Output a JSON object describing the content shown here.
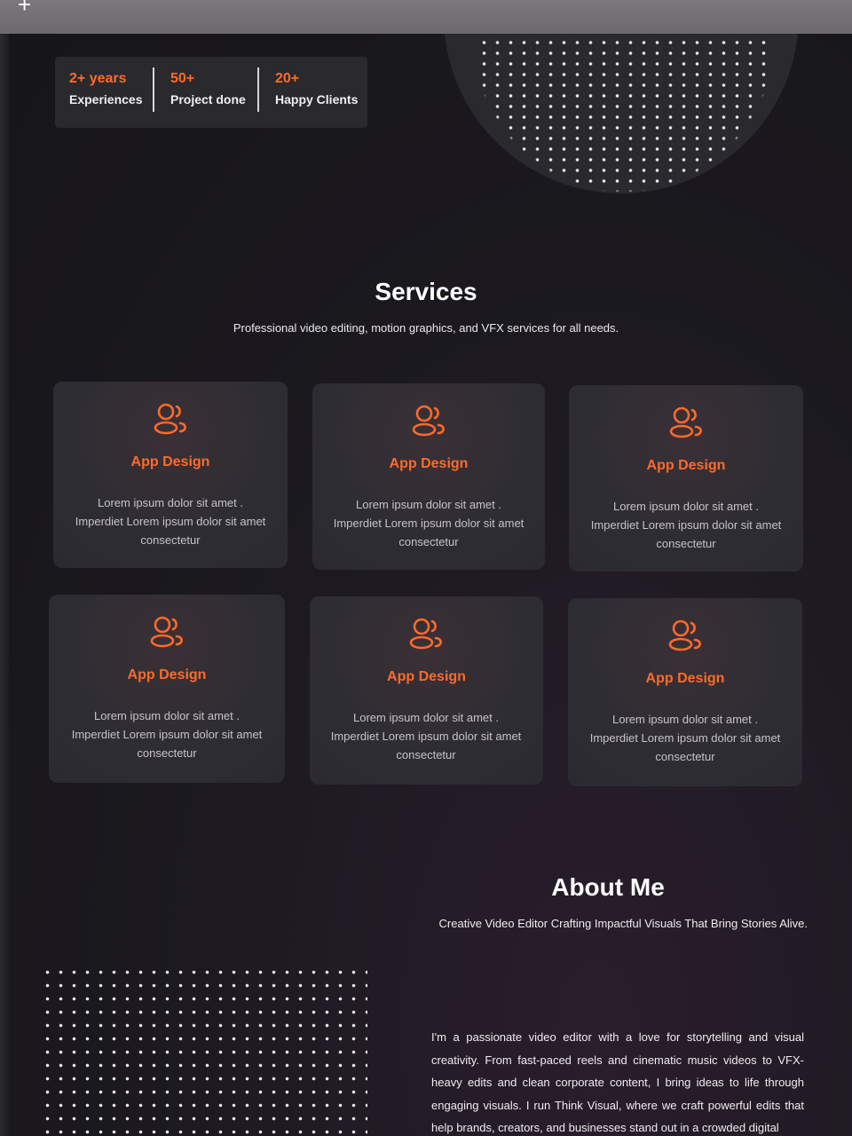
{
  "stats": [
    {
      "value": "2+ years",
      "label": "Experiences"
    },
    {
      "value": "50+",
      "label": "Project done"
    },
    {
      "value": "20+",
      "label": "Happy Clients"
    }
  ],
  "services": {
    "title": "Services",
    "subtitle": "Professional video editing, motion graphics, and VFX services for all needs.",
    "cards": [
      {
        "icon": "users-icon",
        "title": "App Design",
        "description": "Lorem ipsum dolor sit amet . Imperdiet Lorem ipsum dolor sit amet consectetur"
      },
      {
        "icon": "users-icon",
        "title": "App Design",
        "description": "Lorem ipsum dolor sit amet . Imperdiet Lorem ipsum dolor sit amet consectetur"
      },
      {
        "icon": "users-icon",
        "title": "App Design",
        "description": "Lorem ipsum dolor sit amet . Imperdiet Lorem ipsum dolor sit amet consectetur"
      },
      {
        "icon": "users-icon",
        "title": "App Design",
        "description": "Lorem ipsum dolor sit amet . Imperdiet Lorem ipsum dolor sit amet consectetur"
      },
      {
        "icon": "users-icon",
        "title": "App Design",
        "description": "Lorem ipsum dolor sit amet . Imperdiet Lorem ipsum dolor sit amet consectetur"
      },
      {
        "icon": "users-icon",
        "title": "App Design",
        "description": "Lorem ipsum dolor sit amet . Imperdiet Lorem ipsum dolor sit amet consectetur"
      }
    ]
  },
  "about": {
    "title": "About Me",
    "subtitle": "Creative Video Editor Crafting Impactful Visuals That Bring Stories Alive.",
    "body": "I'm a passionate video editor with a love for storytelling and visual creativity. From fast-paced reels and cinematic music videos to VFX-heavy edits and clean corporate content, I bring ideas to life through engaging visuals. I run Think Visual, where we craft powerful edits that help brands, creators, and businesses stand out in a crowded digital"
  },
  "colors": {
    "accent": "#ff6a2a",
    "background": "#1b1a1f",
    "card": "#2e2d33"
  }
}
